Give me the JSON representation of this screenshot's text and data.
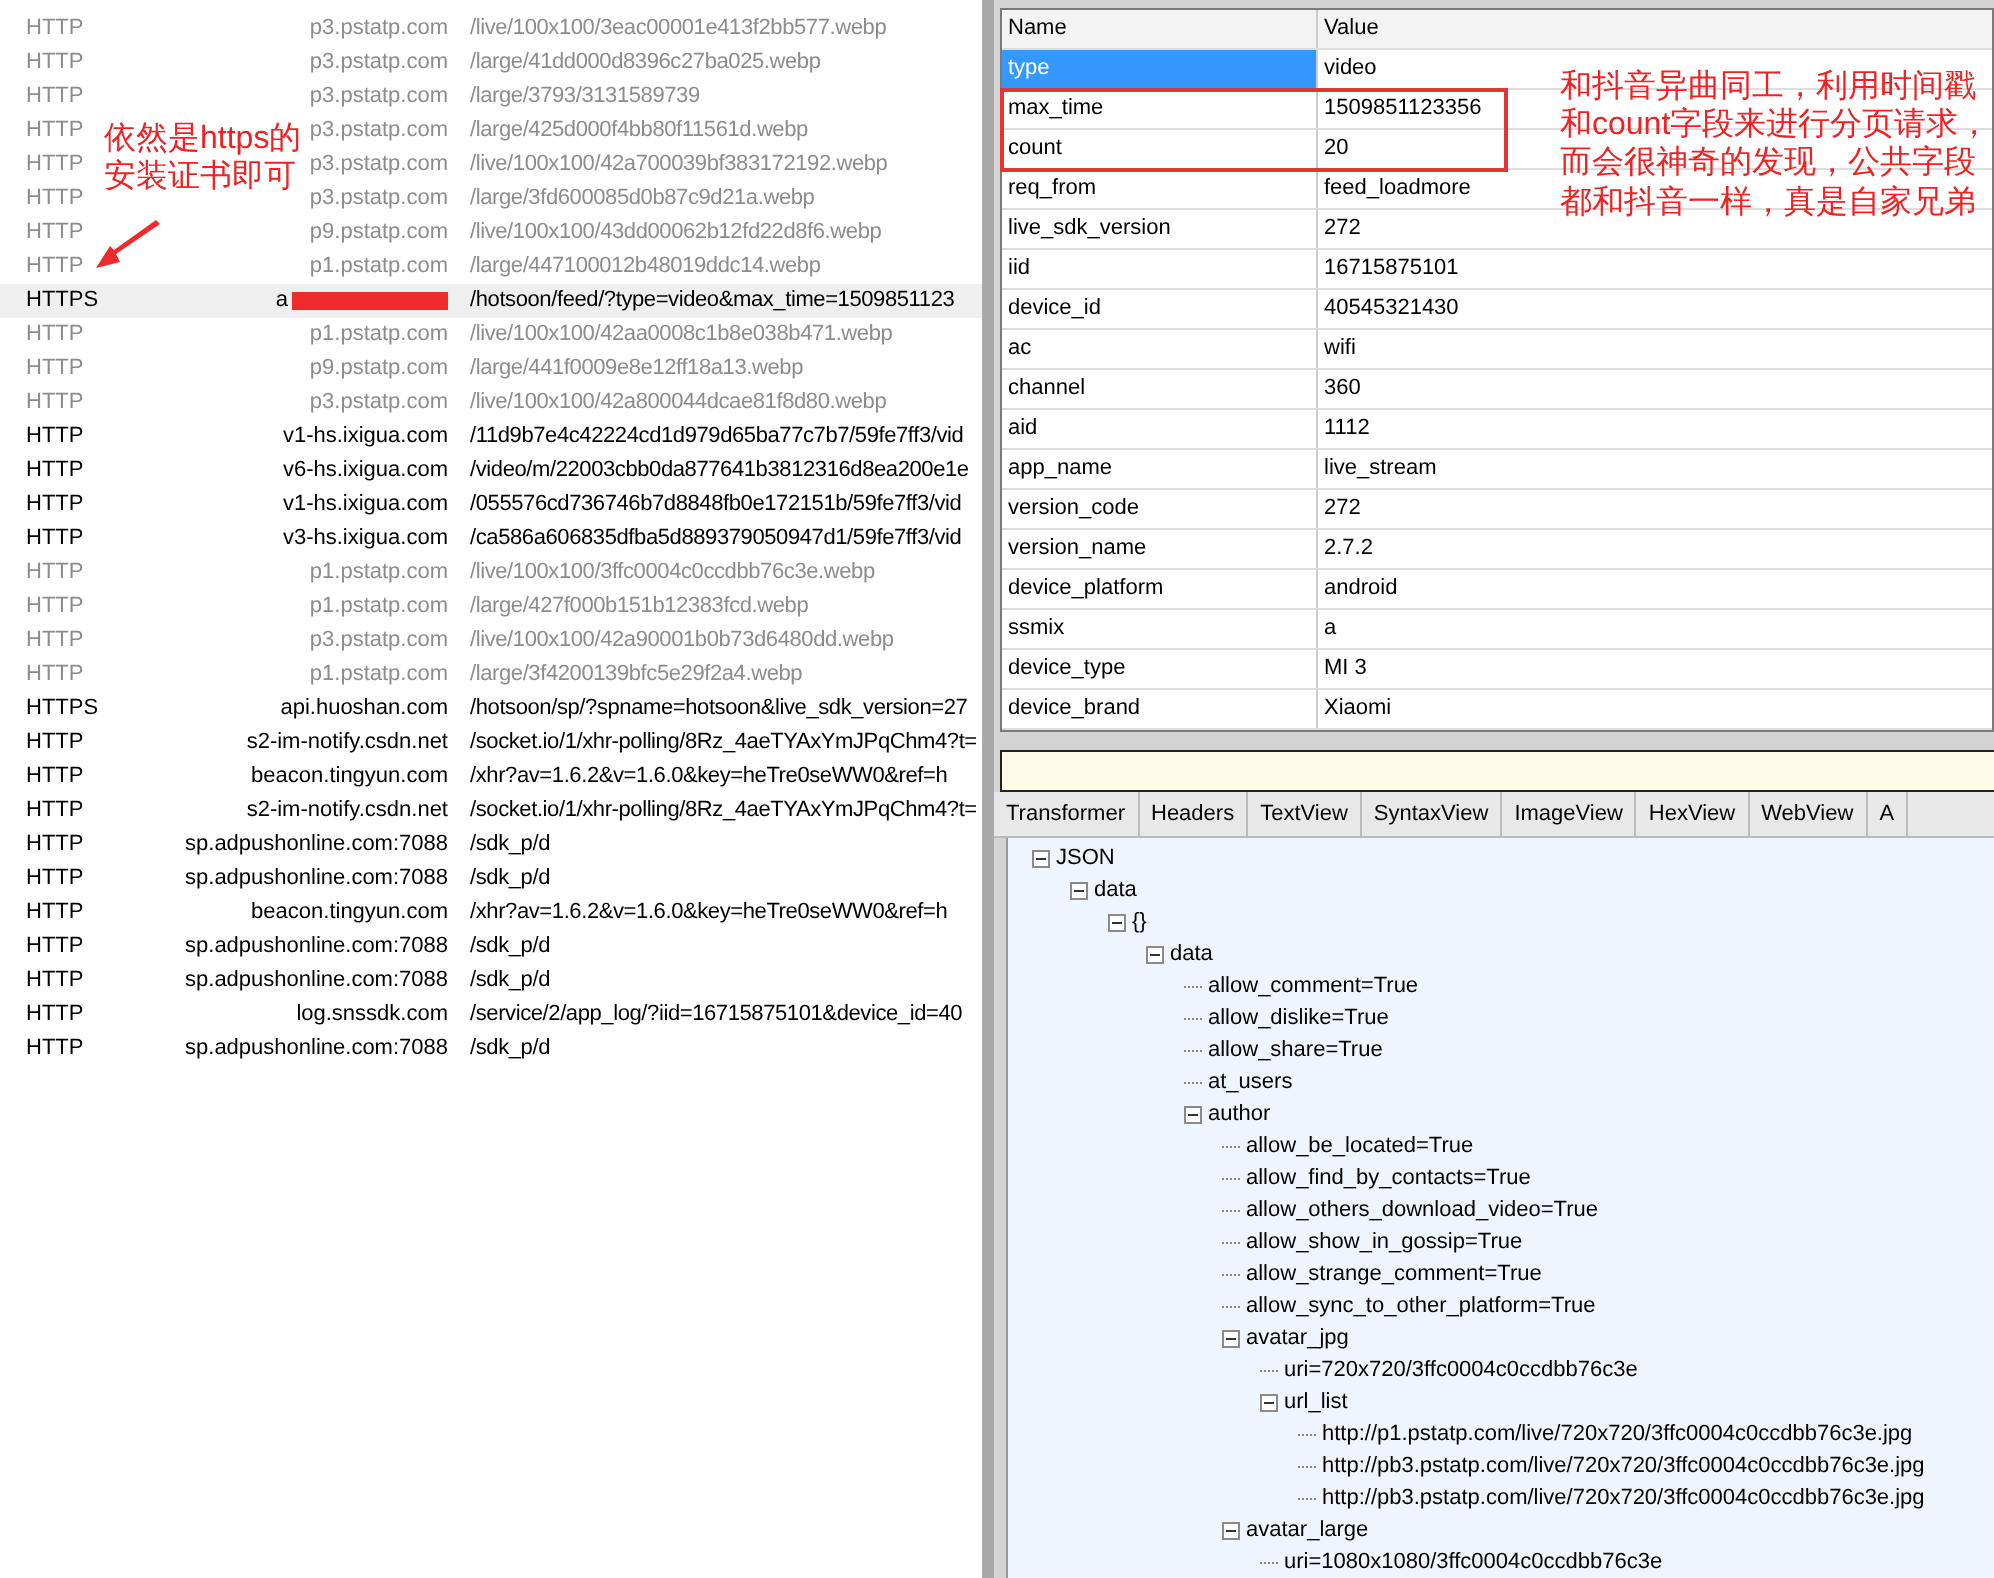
{
  "sessions": [
    {
      "protocol": "HTTP",
      "host": "p3.pstatp.com",
      "url": "/live/100x100/3eac00001e413f2bb577.webp",
      "dimmed": true,
      "selected": false,
      "redacted": false
    },
    {
      "protocol": "HTTP",
      "host": "p3.pstatp.com",
      "url": "/large/41dd000d8396c27ba025.webp",
      "dimmed": true,
      "selected": false,
      "redacted": false
    },
    {
      "protocol": "HTTP",
      "host": "p3.pstatp.com",
      "url": "/large/3793/3131589739",
      "dimmed": true,
      "selected": false,
      "redacted": false
    },
    {
      "protocol": "HTTP",
      "host": "p3.pstatp.com",
      "url": "/large/425d000f4bb80f11561d.webp",
      "dimmed": true,
      "selected": false,
      "redacted": false
    },
    {
      "protocol": "HTTP",
      "host": "p3.pstatp.com",
      "url": "/live/100x100/42a700039bf383172192.webp",
      "dimmed": true,
      "selected": false,
      "redacted": false
    },
    {
      "protocol": "HTTP",
      "host": "p3.pstatp.com",
      "url": "/large/3fd600085d0b87c9d21a.webp",
      "dimmed": true,
      "selected": false,
      "redacted": false
    },
    {
      "protocol": "HTTP",
      "host": "p9.pstatp.com",
      "url": "/live/100x100/43dd00062b12fd22d8f6.webp",
      "dimmed": true,
      "selected": false,
      "redacted": false
    },
    {
      "protocol": "HTTP",
      "host": "p1.pstatp.com",
      "url": "/large/447100012b48019ddc14.webp",
      "dimmed": true,
      "selected": false,
      "redacted": false
    },
    {
      "protocol": "HTTPS",
      "host": "a",
      "url": "/hotsoon/feed/?type=video&max_time=1509851123",
      "dimmed": false,
      "selected": true,
      "redacted": true
    },
    {
      "protocol": "HTTP",
      "host": "p1.pstatp.com",
      "url": "/live/100x100/42aa0008c1b8e038b471.webp",
      "dimmed": true,
      "selected": false,
      "redacted": false
    },
    {
      "protocol": "HTTP",
      "host": "p9.pstatp.com",
      "url": "/large/441f0009e8e12ff18a13.webp",
      "dimmed": true,
      "selected": false,
      "redacted": false
    },
    {
      "protocol": "HTTP",
      "host": "p3.pstatp.com",
      "url": "/live/100x100/42a800044dcae81f8d80.webp",
      "dimmed": true,
      "selected": false,
      "redacted": false
    },
    {
      "protocol": "HTTP",
      "host": "v1-hs.ixigua.com",
      "url": "/11d9b7e4c42224cd1d979d65ba77c7b7/59fe7ff3/vid",
      "dimmed": false,
      "selected": false,
      "redacted": false
    },
    {
      "protocol": "HTTP",
      "host": "v6-hs.ixigua.com",
      "url": "/video/m/22003cbb0da877641b3812316d8ea200e1e",
      "dimmed": false,
      "selected": false,
      "redacted": false
    },
    {
      "protocol": "HTTP",
      "host": "v1-hs.ixigua.com",
      "url": "/055576cd736746b7d8848fb0e172151b/59fe7ff3/vid",
      "dimmed": false,
      "selected": false,
      "redacted": false
    },
    {
      "protocol": "HTTP",
      "host": "v3-hs.ixigua.com",
      "url": "/ca586a606835dfba5d889379050947d1/59fe7ff3/vid",
      "dimmed": false,
      "selected": false,
      "redacted": false
    },
    {
      "protocol": "HTTP",
      "host": "p1.pstatp.com",
      "url": "/live/100x100/3ffc0004c0ccdbb76c3e.webp",
      "dimmed": true,
      "selected": false,
      "redacted": false
    },
    {
      "protocol": "HTTP",
      "host": "p1.pstatp.com",
      "url": "/large/427f000b151b12383fcd.webp",
      "dimmed": true,
      "selected": false,
      "redacted": false
    },
    {
      "protocol": "HTTP",
      "host": "p3.pstatp.com",
      "url": "/live/100x100/42a90001b0b73d6480dd.webp",
      "dimmed": true,
      "selected": false,
      "redacted": false
    },
    {
      "protocol": "HTTP",
      "host": "p1.pstatp.com",
      "url": "/large/3f4200139bfc5e29f2a4.webp",
      "dimmed": true,
      "selected": false,
      "redacted": false
    },
    {
      "protocol": "HTTPS",
      "host": "api.huoshan.com",
      "url": "/hotsoon/sp/?spname=hotsoon&live_sdk_version=27",
      "dimmed": false,
      "selected": false,
      "redacted": false
    },
    {
      "protocol": "HTTP",
      "host": "s2-im-notify.csdn.net",
      "url": "/socket.io/1/xhr-polling/8Rz_4aeTYAxYmJPqChm4?t=",
      "dimmed": false,
      "selected": false,
      "redacted": false
    },
    {
      "protocol": "HTTP",
      "host": "beacon.tingyun.com",
      "url": "/xhr?av=1.6.2&v=1.6.0&key=heTre0seWW0&ref=h",
      "dimmed": false,
      "selected": false,
      "redacted": false
    },
    {
      "protocol": "HTTP",
      "host": "s2-im-notify.csdn.net",
      "url": "/socket.io/1/xhr-polling/8Rz_4aeTYAxYmJPqChm4?t=",
      "dimmed": false,
      "selected": false,
      "redacted": false
    },
    {
      "protocol": "HTTP",
      "host": "sp.adpushonline.com:7088",
      "url": "/sdk_p/d",
      "dimmed": false,
      "selected": false,
      "redacted": false
    },
    {
      "protocol": "HTTP",
      "host": "sp.adpushonline.com:7088",
      "url": "/sdk_p/d",
      "dimmed": false,
      "selected": false,
      "redacted": false
    },
    {
      "protocol": "HTTP",
      "host": "beacon.tingyun.com",
      "url": "/xhr?av=1.6.2&v=1.6.0&key=heTre0seWW0&ref=h",
      "dimmed": false,
      "selected": false,
      "redacted": false
    },
    {
      "protocol": "HTTP",
      "host": "sp.adpushonline.com:7088",
      "url": "/sdk_p/d",
      "dimmed": false,
      "selected": false,
      "redacted": false
    },
    {
      "protocol": "HTTP",
      "host": "sp.adpushonline.com:7088",
      "url": "/sdk_p/d",
      "dimmed": false,
      "selected": false,
      "redacted": false
    },
    {
      "protocol": "HTTP",
      "host": "log.snssdk.com",
      "url": "/service/2/app_log/?iid=16715875101&device_id=40",
      "dimmed": false,
      "selected": false,
      "redacted": false
    },
    {
      "protocol": "HTTP",
      "host": "sp.adpushonline.com:7088",
      "url": "/sdk_p/d",
      "dimmed": false,
      "selected": false,
      "redacted": false
    }
  ],
  "session_note": {
    "lines": [
      "依然是https的",
      "安装证书即可"
    ]
  },
  "query": {
    "columns": [
      "Name",
      "Value"
    ],
    "params": [
      {
        "name": "type",
        "value": "video",
        "selected": true,
        "highlighted": false
      },
      {
        "name": "max_time",
        "value": "1509851123356",
        "selected": false,
        "highlighted": true
      },
      {
        "name": "count",
        "value": "20",
        "selected": false,
        "highlighted": true
      },
      {
        "name": "req_from",
        "value": "feed_loadmore",
        "selected": false,
        "highlighted": false
      },
      {
        "name": "live_sdk_version",
        "value": "272",
        "selected": false,
        "highlighted": false
      },
      {
        "name": "iid",
        "value": "16715875101",
        "selected": false,
        "highlighted": false
      },
      {
        "name": "device_id",
        "value": "40545321430",
        "selected": false,
        "highlighted": false
      },
      {
        "name": "ac",
        "value": "wifi",
        "selected": false,
        "highlighted": false
      },
      {
        "name": "channel",
        "value": "360",
        "selected": false,
        "highlighted": false
      },
      {
        "name": "aid",
        "value": "1112",
        "selected": false,
        "highlighted": false
      },
      {
        "name": "app_name",
        "value": "live_stream",
        "selected": false,
        "highlighted": false
      },
      {
        "name": "version_code",
        "value": "272",
        "selected": false,
        "highlighted": false
      },
      {
        "name": "version_name",
        "value": "2.7.2",
        "selected": false,
        "highlighted": false
      },
      {
        "name": "device_platform",
        "value": "android",
        "selected": false,
        "highlighted": false
      },
      {
        "name": "ssmix",
        "value": "a",
        "selected": false,
        "highlighted": false
      },
      {
        "name": "device_type",
        "value": "MI 3",
        "selected": false,
        "highlighted": false
      },
      {
        "name": "device_brand",
        "value": "Xiaomi",
        "selected": false,
        "highlighted": false
      }
    ],
    "note": {
      "lines": [
        "和抖音异曲同工，利用时间戳",
        "和count字段来进行分页请求，",
        "而会很神奇的发现，公共字段",
        "都和抖音一样，真是自家兄弟"
      ]
    }
  },
  "response_tabs": [
    "Transformer",
    "Headers",
    "TextView",
    "SyntaxView",
    "ImageView",
    "HexView",
    "WebView",
    "A"
  ],
  "json_tree": [
    {
      "label": "JSON",
      "expanded": true,
      "children": [
        {
          "label": "data",
          "expanded": true,
          "children": [
            {
              "label": "{}",
              "expanded": true,
              "children": [
                {
                  "label": "data",
                  "expanded": true,
                  "children": [
                    {
                      "label": "allow_comment=True"
                    },
                    {
                      "label": "allow_dislike=True"
                    },
                    {
                      "label": "allow_share=True"
                    },
                    {
                      "label": "at_users"
                    },
                    {
                      "label": "author",
                      "expanded": true,
                      "children": [
                        {
                          "label": "allow_be_located=True"
                        },
                        {
                          "label": "allow_find_by_contacts=True"
                        },
                        {
                          "label": "allow_others_download_video=True"
                        },
                        {
                          "label": "allow_show_in_gossip=True"
                        },
                        {
                          "label": "allow_strange_comment=True"
                        },
                        {
                          "label": "allow_sync_to_other_platform=True"
                        },
                        {
                          "label": "avatar_jpg",
                          "expanded": true,
                          "children": [
                            {
                              "label": "uri=720x720/3ffc0004c0ccdbb76c3e"
                            },
                            {
                              "label": "url_list",
                              "expanded": true,
                              "children": [
                                {
                                  "label": "http://p1.pstatp.com/live/720x720/3ffc0004c0ccdbb76c3e.jpg"
                                },
                                {
                                  "label": "http://pb3.pstatp.com/live/720x720/3ffc0004c0ccdbb76c3e.jpg"
                                },
                                {
                                  "label": "http://pb3.pstatp.com/live/720x720/3ffc0004c0ccdbb76c3e.jpg"
                                }
                              ]
                            }
                          ]
                        },
                        {
                          "label": "avatar_large",
                          "expanded": true,
                          "children": [
                            {
                              "label": "uri=1080x1080/3ffc0004c0ccdbb76c3e"
                            }
                          ]
                        }
                      ]
                    }
                  ]
                }
              ]
            }
          ]
        }
      ]
    }
  ]
}
